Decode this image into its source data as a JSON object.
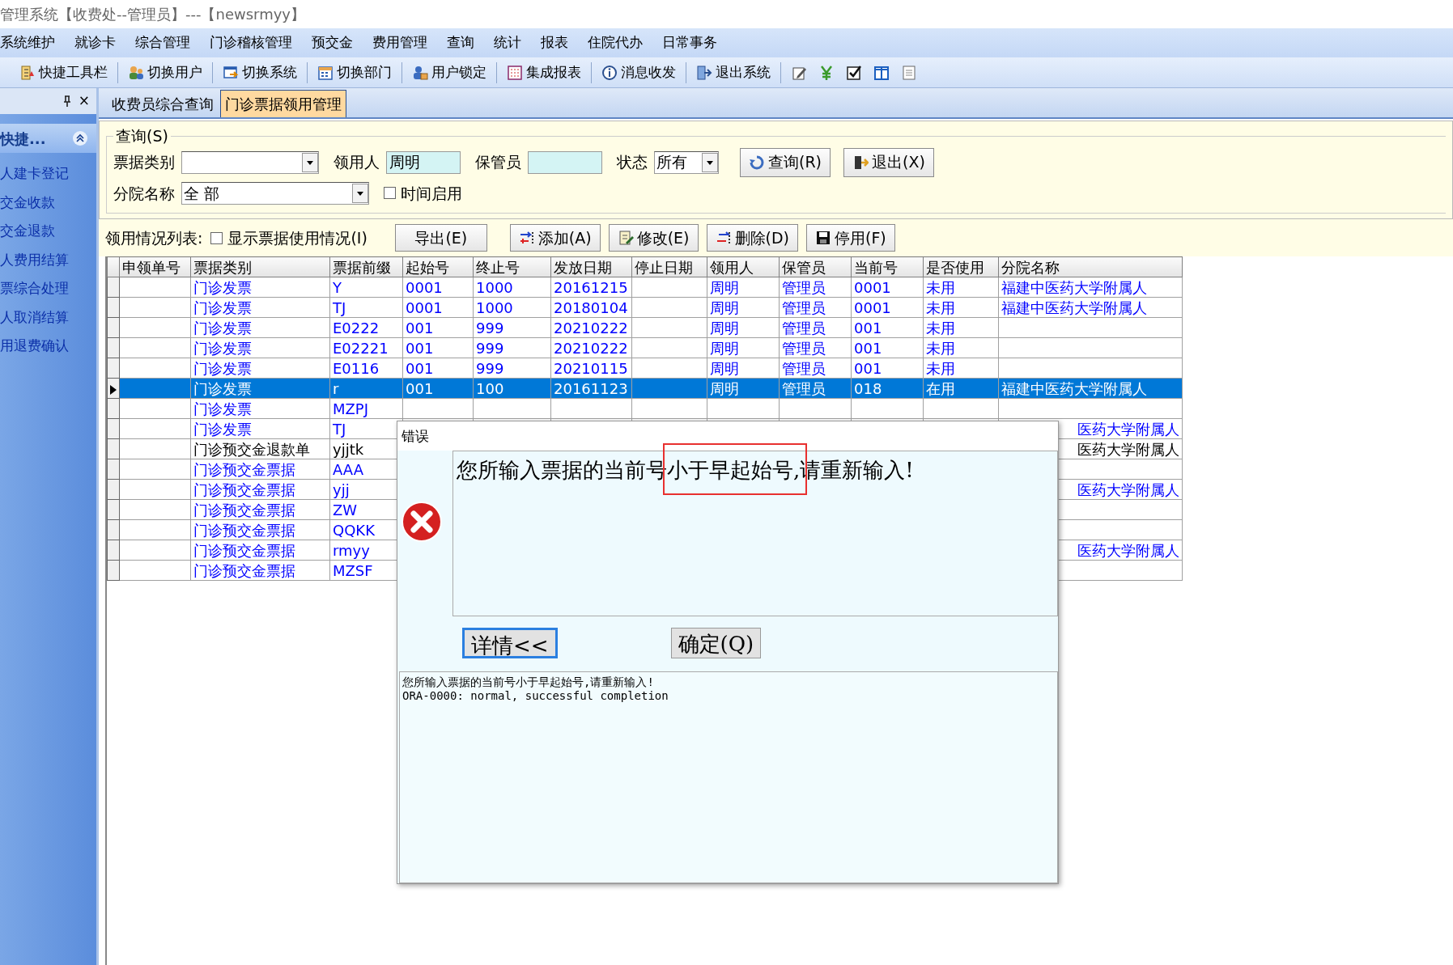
{
  "window": {
    "title": "管理系统【收费处--管理员】---【newsrmyy】"
  },
  "menu": [
    "系统维护",
    "就诊卡",
    "综合管理",
    "门诊稽核管理",
    "预交金",
    "费用管理",
    "查询",
    "统计",
    "报表",
    "住院代办",
    "日常事务"
  ],
  "toolbar": [
    "快捷工具栏",
    "切换用户",
    "切换系统",
    "切换部门",
    "用户锁定",
    "集成报表",
    "消息收发",
    "退出系统"
  ],
  "sidebar": {
    "close": "×",
    "title": "快捷...",
    "items": [
      "人建卡登记",
      "交金收款",
      "交金退款",
      "人费用结算",
      "票综合处理",
      "人取消结算",
      "用退费确认"
    ]
  },
  "tabs": [
    {
      "label": "收费员综合查询",
      "selected": false
    },
    {
      "label": "门诊票据领用管理",
      "selected": true
    }
  ],
  "query": {
    "legend": "查询(S)",
    "rows": [
      [
        {
          "kind": "select",
          "label": "票据类别"
        },
        {
          "kind": "input",
          "label": "领用人",
          "value": "周明"
        },
        {
          "kind": "input",
          "label": "保管员"
        },
        {
          "kind": "select",
          "label": "状态",
          "value": "所有"
        },
        {
          "kind": "button",
          "label": "查询(R)"
        },
        {
          "kind": "button",
          "label": "退出(X)"
        }
      ],
      [
        {
          "kind": "select",
          "label": "分院名称",
          "value": "全 部"
        },
        {
          "kind": "checkbox",
          "label": "时间启用",
          "checked": false
        }
      ]
    ]
  },
  "list": {
    "label": "领用情况列表:",
    "controls": [
      {
        "kind": "checkbox",
        "label": "显示票据使用情况(I)",
        "checked": false
      },
      {
        "kind": "button",
        "label": "导出(E)"
      },
      {
        "kind": "button",
        "label": "添加(A)"
      },
      {
        "kind": "button",
        "label": "修改(E)"
      },
      {
        "kind": "button",
        "label": "删除(D)"
      },
      {
        "kind": "button",
        "label": "停用(F)"
      }
    ]
  },
  "table": {
    "columns": [
      "申领单号",
      "票据类别",
      "票据前缀",
      "起始号",
      "终止号",
      "发放日期",
      "停止日期",
      "领用人",
      "保管员",
      "当前号",
      "是否使用",
      "分院名称"
    ],
    "rows": [
      {
        "selected": false,
        "color": "#0000ff",
        "cells": [
          null,
          "门诊发票",
          "Y",
          "0001",
          "1000",
          "20161215",
          null,
          "周明",
          "管理员",
          "0001",
          "未用",
          "福建中医药大学附属人"
        ]
      },
      {
        "selected": false,
        "color": "#0000ff",
        "cells": [
          null,
          "门诊发票",
          "TJ",
          "0001",
          "1000",
          "20180104",
          null,
          "周明",
          "管理员",
          "0001",
          "未用",
          "福建中医药大学附属人"
        ]
      },
      {
        "selected": false,
        "color": "#0000ff",
        "cells": [
          null,
          "门诊发票",
          "E0222",
          "001",
          "999",
          "20210222",
          null,
          "周明",
          "管理员",
          "001",
          "未用",
          null
        ]
      },
      {
        "selected": false,
        "color": "#0000ff",
        "cells": [
          null,
          "门诊发票",
          "E02221",
          "001",
          "999",
          "20210222",
          null,
          "周明",
          "管理员",
          "001",
          "未用",
          null
        ]
      },
      {
        "selected": false,
        "color": "#0000ff",
        "cells": [
          null,
          "门诊发票",
          "E0116",
          "001",
          "999",
          "20210115",
          null,
          "周明",
          "管理员",
          "001",
          "未用",
          null
        ]
      },
      {
        "selected": true,
        "cells": [
          null,
          "门诊发票",
          "r",
          "001",
          "100",
          "20161123",
          null,
          "周明",
          "管理员",
          "018",
          "在用",
          "福建中医药大学附属人"
        ]
      },
      {
        "selected": false,
        "color": "#0000ff",
        "cells": [
          null,
          "门诊发票",
          "MZPJ",
          null,
          null,
          null,
          null,
          null,
          null,
          null,
          null,
          null
        ]
      },
      {
        "selected": false,
        "color": "#0000ff",
        "cells": [
          null,
          "门诊发票",
          "TJ",
          null,
          null,
          null,
          null,
          null,
          null,
          null,
          null,
          "医药大学附属人"
        ]
      },
      {
        "selected": false,
        "color": "#000000",
        "cells": [
          null,
          "门诊预交金退款单",
          "yjjtk",
          null,
          null,
          null,
          null,
          null,
          null,
          null,
          null,
          "医药大学附属人"
        ]
      },
      {
        "selected": false,
        "color": "#0000ff",
        "cells": [
          null,
          "门诊预交金票据",
          "AAA",
          null,
          null,
          null,
          null,
          null,
          null,
          null,
          null,
          null
        ]
      },
      {
        "selected": false,
        "color": "#0000ff",
        "cells": [
          null,
          "门诊预交金票据",
          "yjj",
          null,
          null,
          null,
          null,
          null,
          null,
          null,
          null,
          "医药大学附属人"
        ]
      },
      {
        "selected": false,
        "color": "#0000ff",
        "cells": [
          null,
          "门诊预交金票据",
          "ZW",
          null,
          null,
          null,
          null,
          null,
          null,
          null,
          null,
          null
        ]
      },
      {
        "selected": false,
        "color": "#0000ff",
        "cells": [
          null,
          "门诊预交金票据",
          "QQKK",
          null,
          null,
          null,
          null,
          null,
          null,
          null,
          null,
          null
        ]
      },
      {
        "selected": false,
        "color": "#0000ff",
        "cells": [
          null,
          "门诊预交金票据",
          "rmyy",
          null,
          null,
          null,
          null,
          null,
          null,
          null,
          null,
          "医药大学附属人"
        ]
      },
      {
        "selected": false,
        "color": "#0000ff",
        "cells": [
          null,
          "门诊预交金票据",
          "MZSF",
          null,
          null,
          null,
          null,
          null,
          null,
          null,
          null,
          null
        ]
      }
    ]
  },
  "dialog": {
    "title": "错误",
    "message": "您所输入票据的当前号小于早起始号,请重新输入!",
    "highlight": true,
    "buttons": [
      {
        "label": "详情<<",
        "focused": true
      },
      {
        "label": "确定(Q)",
        "focused": false
      }
    ],
    "details": [
      "您所输入票据的当前号小于早起始号,请重新输入!",
      "ORA-0000: normal, successful completion"
    ]
  }
}
